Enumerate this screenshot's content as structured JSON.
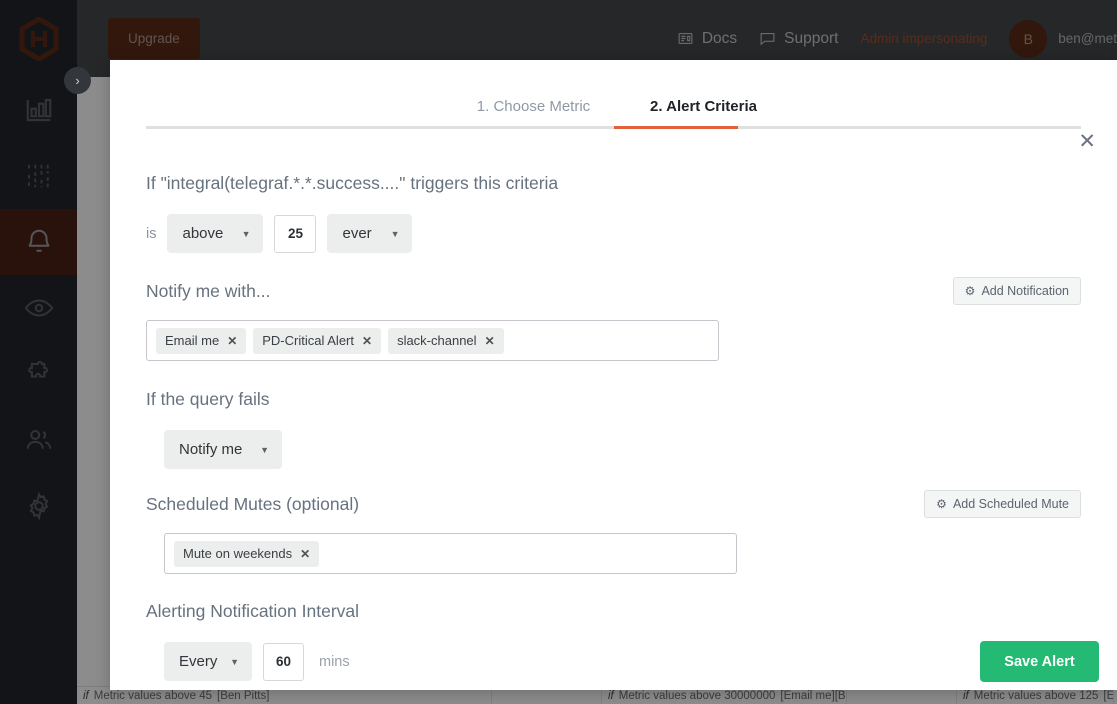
{
  "topbar": {
    "upgrade_label": "Upgrade",
    "docs_label": "Docs",
    "docs_icon": "newspaper-icon",
    "support_label": "Support",
    "support_icon": "chat-bubble-icon",
    "admin_label": "Admin impersonating",
    "avatar_initial": "B",
    "user_email": "ben@met"
  },
  "sidebar": {
    "logo_icon": "hexagon-logo-icon",
    "toggle_icon": "chevron-right-icon",
    "items": [
      {
        "icon": "bar-chart-icon",
        "name": "metrics",
        "active": false
      },
      {
        "icon": "dashboards-sliders-icon",
        "name": "dashboards",
        "active": false
      },
      {
        "icon": "bell-icon",
        "name": "alerts",
        "active": true
      },
      {
        "icon": "eye-icon",
        "name": "monitoring",
        "active": false
      },
      {
        "icon": "puzzle-piece-icon",
        "name": "integrations",
        "active": false
      },
      {
        "icon": "users-icon",
        "name": "team",
        "active": false
      },
      {
        "icon": "gear-icon",
        "name": "settings",
        "active": false
      }
    ]
  },
  "background_table": {
    "rows": [
      {
        "prefix": "if",
        "text": "Metric values above 45",
        "owner": "[Ben Pitts]"
      },
      {
        "prefix": "if",
        "text": "Metric values above 30000000",
        "owner": "[Email me][Ben Pitts]"
      },
      {
        "prefix": "if",
        "text": "Metric values above 125",
        "owner": "[Email me]"
      }
    ]
  },
  "modal": {
    "close_icon": "close-icon",
    "tabs": [
      {
        "label": "1. Choose Metric",
        "active": false
      },
      {
        "label": "2. Alert Criteria",
        "active": true
      }
    ],
    "criteria": {
      "heading": "If \"integral(telegraf.*.*.success....\" triggers this criteria",
      "is_label": "is",
      "comparator_value": "above",
      "threshold_value": "25",
      "frequency_value": "ever"
    },
    "notify": {
      "heading": "Notify me with...",
      "add_button_label": "Add Notification",
      "add_button_icon": "gear-icon",
      "tags": [
        "Email me",
        "PD-Critical Alert",
        "slack-channel"
      ]
    },
    "query_fails": {
      "heading": "If the query fails",
      "action_value": "Notify me"
    },
    "scheduled_mutes": {
      "heading": "Scheduled Mutes (optional)",
      "add_button_label": "Add Scheduled Mute",
      "add_button_icon": "gear-icon",
      "tags": [
        "Mute on weekends"
      ]
    },
    "interval": {
      "heading": "Alerting Notification Interval",
      "mode_value": "Every",
      "minutes_value": "60",
      "unit_label": "mins",
      "save_label": "Save Alert"
    }
  },
  "colors": {
    "accent_orange": "#e2613b",
    "save_green": "#25ba73",
    "rail_dark": "#23262a",
    "rail_active": "#4a2115",
    "topbar": "#44474b"
  }
}
